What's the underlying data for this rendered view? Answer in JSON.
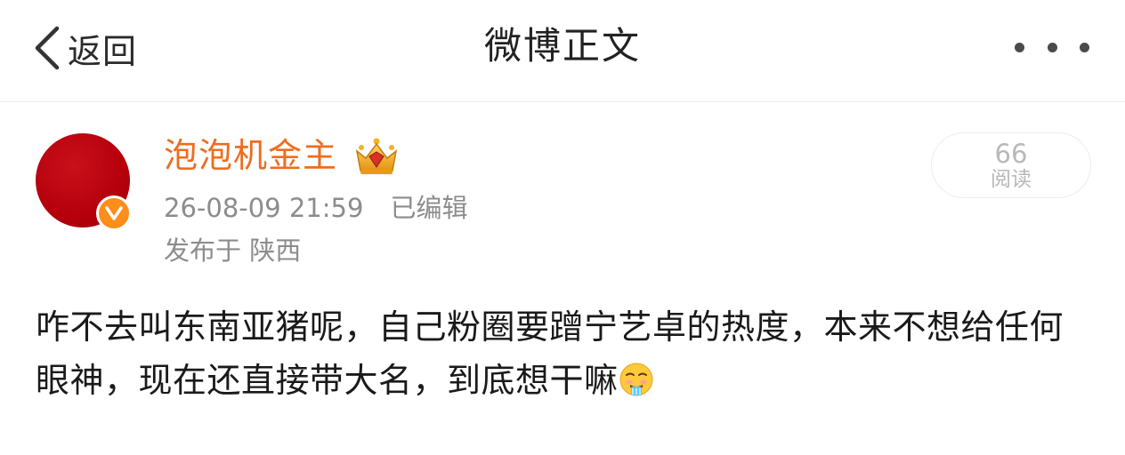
{
  "header": {
    "back_label": "返回",
    "title": "微博正文",
    "icons": {
      "back": "chevron-left-icon",
      "more": "more-dots-icon"
    }
  },
  "post": {
    "author": {
      "name": "泡泡机金主",
      "name_color": "#ee6d1f",
      "avatar_color": "#b5000c",
      "verified_badge": "orange-v-badge-icon",
      "member_badge": "crown-badge-icon"
    },
    "timestamp": "26-08-09 21:59",
    "edited_label": "已编辑",
    "location": "发布于 陕西",
    "read_count": "66",
    "read_label": "阅读",
    "text": "咋不去叫东南亚猪呢，自己粉圈要蹭宁艺卓的热度，本来不想给任何眼神，现在还直接带大名，到底想干嘛",
    "trailing_emoji": "drooling-face-emoji"
  }
}
